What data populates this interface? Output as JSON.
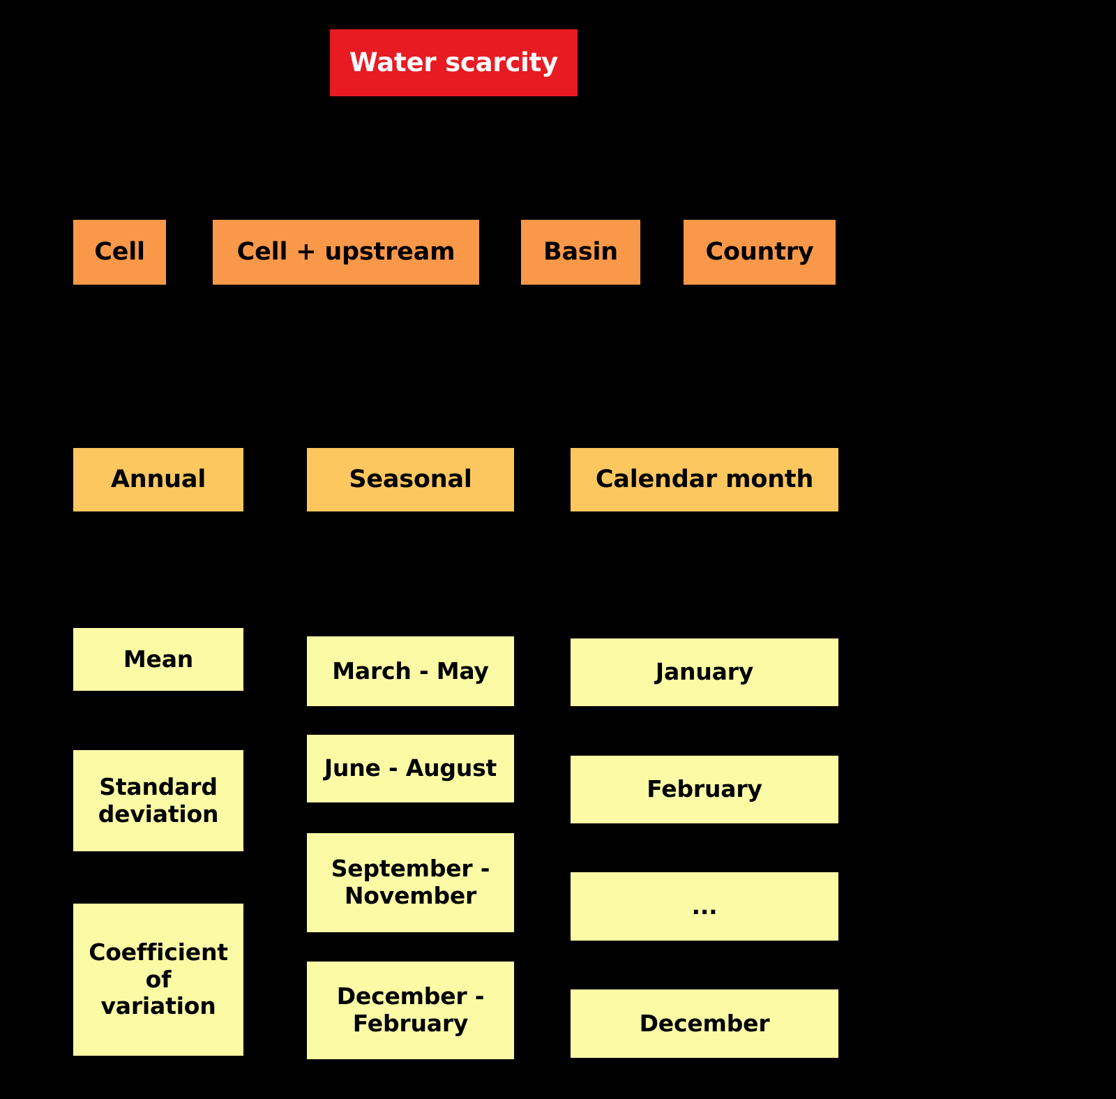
{
  "diagram": {
    "title": "Water scarcity",
    "background_color": "#000000",
    "levels": {
      "root": {
        "color": "#E81B23",
        "text_color": "#FFFFFF"
      },
      "spatial": {
        "color": "#FA9849",
        "text_color": "#000000"
      },
      "temporal": {
        "color": "#FCC75E",
        "text_color": "#000000"
      },
      "leaf": {
        "color": "#FBFBA6",
        "text_color": "#000000"
      }
    }
  },
  "root": {
    "label": "Water scarcity"
  },
  "spatial_scales": [
    {
      "label": "Cell"
    },
    {
      "label": "Cell + upstream"
    },
    {
      "label": "Basin"
    },
    {
      "label": "Country"
    }
  ],
  "temporal_scales": [
    {
      "label": "Annual"
    },
    {
      "label": "Seasonal"
    },
    {
      "label": "Calendar month"
    }
  ],
  "annual_metrics": [
    {
      "label": "Mean"
    },
    {
      "label": "Standard\ndeviation"
    },
    {
      "label": "Coefficient\nof\nvariation"
    }
  ],
  "seasonal_periods": [
    {
      "label": "March - May"
    },
    {
      "label": "June - August"
    },
    {
      "label": "September -\nNovember"
    },
    {
      "label": "December -\nFebruary"
    }
  ],
  "calendar_months": [
    {
      "label": "January"
    },
    {
      "label": "February"
    },
    {
      "label": "..."
    },
    {
      "label": "December"
    }
  ]
}
